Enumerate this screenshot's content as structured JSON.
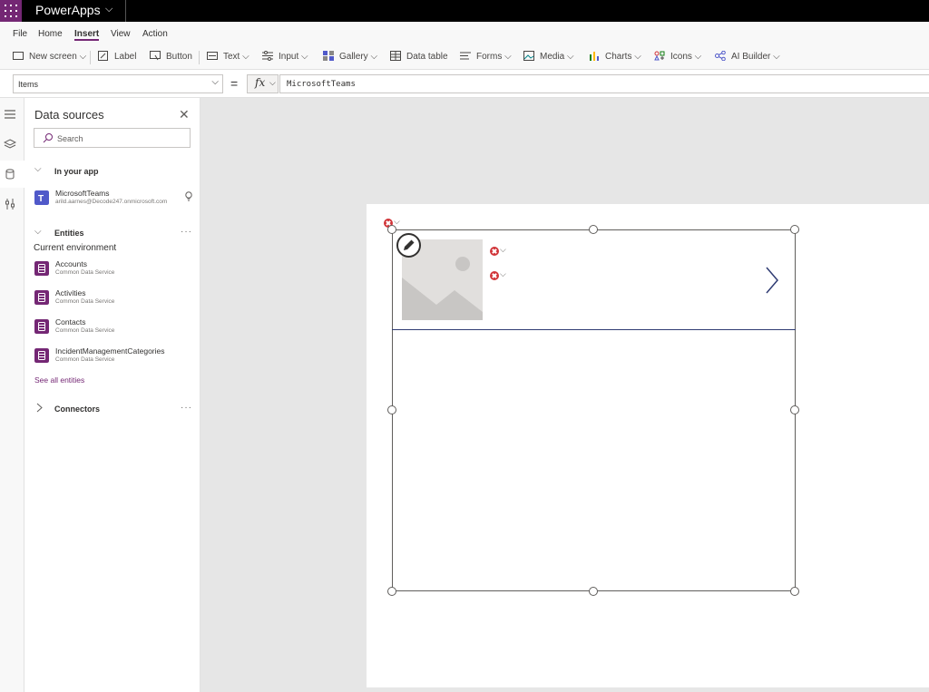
{
  "app": {
    "title": "PowerApps",
    "chevron": "⌵"
  },
  "menu": {
    "items": [
      {
        "label": "File"
      },
      {
        "label": "Home"
      },
      {
        "label": "Insert",
        "active": true
      },
      {
        "label": "View"
      },
      {
        "label": "Action"
      }
    ]
  },
  "ribbon": {
    "items": [
      {
        "label": "New screen ⌵",
        "icon": "new-screen-icon"
      },
      {
        "label": "Label",
        "icon": "label-icon"
      },
      {
        "label": "Button",
        "icon": "button-icon"
      },
      {
        "label": "Text ⌵",
        "icon": "text-icon"
      },
      {
        "label": "Input ⌵",
        "icon": "input-icon"
      },
      {
        "label": "Gallery ⌵",
        "icon": "gallery-icon"
      },
      {
        "label": "Data table",
        "icon": "data-table-icon"
      },
      {
        "label": "Forms ⌵",
        "icon": "forms-icon"
      },
      {
        "label": "Media ⌵",
        "icon": "media-icon"
      },
      {
        "label": "Charts ⌵",
        "icon": "charts-icon"
      },
      {
        "label": "Icons ⌵",
        "icon": "icons-icon"
      },
      {
        "label": "AI Builder ⌵",
        "icon": "ai-builder-icon"
      }
    ]
  },
  "formula_bar": {
    "property": "Items",
    "equals": "=",
    "fx": "fx",
    "fx_chevron": "⌵",
    "formula": "MicrosoftTeams"
  },
  "panel": {
    "title": "Data sources",
    "close": "✕",
    "search_placeholder": "Search",
    "in_your_app": {
      "label": "In your app",
      "items": [
        {
          "name": "MicrosoftTeams",
          "sub": "arild.aarnes@Decode247.onmicrosoft.com"
        }
      ]
    },
    "entities": {
      "label": "Entities",
      "more": "···",
      "environment": "Current environment",
      "items": [
        {
          "name": "Accounts",
          "sub": "Common Data Service"
        },
        {
          "name": "Activities",
          "sub": "Common Data Service"
        },
        {
          "name": "Contacts",
          "sub": "Common Data Service"
        },
        {
          "name": "IncidentManagementCategories",
          "sub": "Common Data Service"
        }
      ],
      "see_all": "See all entities"
    },
    "connectors": {
      "label": "Connectors",
      "more": "···"
    }
  },
  "colors": {
    "brand": "#742774",
    "error": "#d13438",
    "teams": "#5059c9",
    "entity": "#742774"
  }
}
